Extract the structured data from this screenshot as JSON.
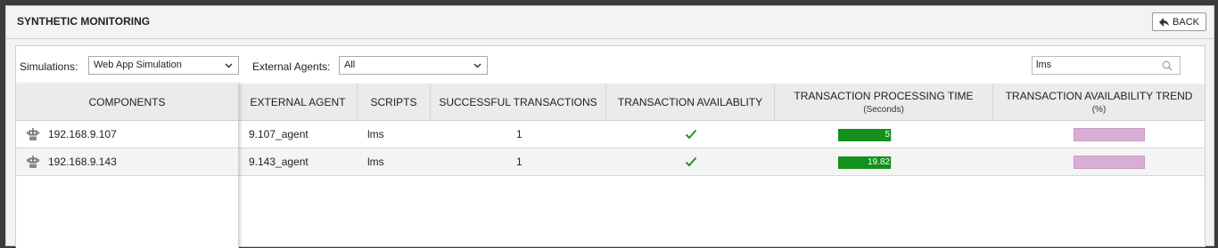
{
  "header": {
    "title": "SYNTHETIC MONITORING",
    "back_label": "BACK"
  },
  "filters": {
    "simulations_label": "Simulations:",
    "simulations_value": "Web App Simulation",
    "agents_label": "External Agents:",
    "agents_value": "All",
    "search_value": "lms"
  },
  "components": {
    "header": "COMPONENTS",
    "items": [
      {
        "label": "192.168.9.107",
        "icon": "agent-robot-icon"
      },
      {
        "label": "192.168.9.143",
        "icon": "agent-robot-icon"
      }
    ]
  },
  "table": {
    "columns": [
      {
        "label": "EXTERNAL AGENT",
        "sub": ""
      },
      {
        "label": "SCRIPTS",
        "sub": ""
      },
      {
        "label": "SUCCESSFUL TRANSACTIONS",
        "sub": ""
      },
      {
        "label": "TRANSACTION AVAILABLITY",
        "sub": ""
      },
      {
        "label": "TRANSACTION PROCESSING TIME",
        "sub": "(Seconds)"
      },
      {
        "label": "TRANSACTION AVAILABILITY TREND",
        "sub": "(%)"
      }
    ],
    "rows": [
      {
        "agent": "9.107_agent",
        "script": "lms",
        "successful": "1",
        "available": "check-icon",
        "time": "5",
        "time_fraction": 0.98,
        "trend_color": "#d9aed4"
      },
      {
        "agent": "9.143_agent",
        "script": "lms",
        "successful": "1",
        "available": "check-icon",
        "time": "19.82",
        "time_fraction": 0.98,
        "trend_color": "#d9aed4"
      }
    ]
  },
  "colors": {
    "bar_green": "#14901c",
    "check_green": "#1b9a1b",
    "trend_pink": "#d9aed4"
  }
}
